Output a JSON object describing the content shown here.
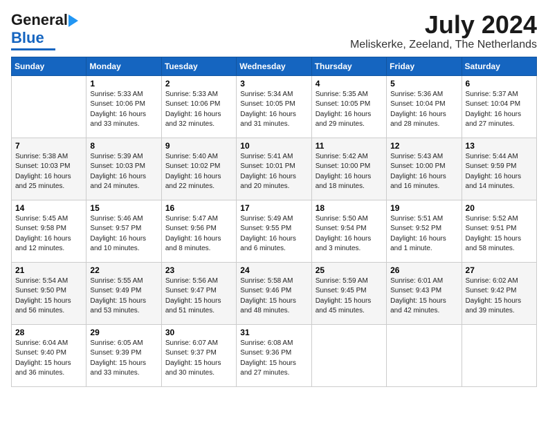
{
  "header": {
    "logo_general": "General",
    "logo_blue": "Blue",
    "title": "July 2024",
    "subtitle": "Meliskerke, Zeeland, The Netherlands"
  },
  "days_of_week": [
    "Sunday",
    "Monday",
    "Tuesday",
    "Wednesday",
    "Thursday",
    "Friday",
    "Saturday"
  ],
  "weeks": [
    [
      {
        "day": "",
        "info": ""
      },
      {
        "day": "1",
        "info": "Sunrise: 5:33 AM\nSunset: 10:06 PM\nDaylight: 16 hours\nand 33 minutes."
      },
      {
        "day": "2",
        "info": "Sunrise: 5:33 AM\nSunset: 10:06 PM\nDaylight: 16 hours\nand 32 minutes."
      },
      {
        "day": "3",
        "info": "Sunrise: 5:34 AM\nSunset: 10:05 PM\nDaylight: 16 hours\nand 31 minutes."
      },
      {
        "day": "4",
        "info": "Sunrise: 5:35 AM\nSunset: 10:05 PM\nDaylight: 16 hours\nand 29 minutes."
      },
      {
        "day": "5",
        "info": "Sunrise: 5:36 AM\nSunset: 10:04 PM\nDaylight: 16 hours\nand 28 minutes."
      },
      {
        "day": "6",
        "info": "Sunrise: 5:37 AM\nSunset: 10:04 PM\nDaylight: 16 hours\nand 27 minutes."
      }
    ],
    [
      {
        "day": "7",
        "info": "Sunrise: 5:38 AM\nSunset: 10:03 PM\nDaylight: 16 hours\nand 25 minutes."
      },
      {
        "day": "8",
        "info": "Sunrise: 5:39 AM\nSunset: 10:03 PM\nDaylight: 16 hours\nand 24 minutes."
      },
      {
        "day": "9",
        "info": "Sunrise: 5:40 AM\nSunset: 10:02 PM\nDaylight: 16 hours\nand 22 minutes."
      },
      {
        "day": "10",
        "info": "Sunrise: 5:41 AM\nSunset: 10:01 PM\nDaylight: 16 hours\nand 20 minutes."
      },
      {
        "day": "11",
        "info": "Sunrise: 5:42 AM\nSunset: 10:00 PM\nDaylight: 16 hours\nand 18 minutes."
      },
      {
        "day": "12",
        "info": "Sunrise: 5:43 AM\nSunset: 10:00 PM\nDaylight: 16 hours\nand 16 minutes."
      },
      {
        "day": "13",
        "info": "Sunrise: 5:44 AM\nSunset: 9:59 PM\nDaylight: 16 hours\nand 14 minutes."
      }
    ],
    [
      {
        "day": "14",
        "info": "Sunrise: 5:45 AM\nSunset: 9:58 PM\nDaylight: 16 hours\nand 12 minutes."
      },
      {
        "day": "15",
        "info": "Sunrise: 5:46 AM\nSunset: 9:57 PM\nDaylight: 16 hours\nand 10 minutes."
      },
      {
        "day": "16",
        "info": "Sunrise: 5:47 AM\nSunset: 9:56 PM\nDaylight: 16 hours\nand 8 minutes."
      },
      {
        "day": "17",
        "info": "Sunrise: 5:49 AM\nSunset: 9:55 PM\nDaylight: 16 hours\nand 6 minutes."
      },
      {
        "day": "18",
        "info": "Sunrise: 5:50 AM\nSunset: 9:54 PM\nDaylight: 16 hours\nand 3 minutes."
      },
      {
        "day": "19",
        "info": "Sunrise: 5:51 AM\nSunset: 9:52 PM\nDaylight: 16 hours\nand 1 minute."
      },
      {
        "day": "20",
        "info": "Sunrise: 5:52 AM\nSunset: 9:51 PM\nDaylight: 15 hours\nand 58 minutes."
      }
    ],
    [
      {
        "day": "21",
        "info": "Sunrise: 5:54 AM\nSunset: 9:50 PM\nDaylight: 15 hours\nand 56 minutes."
      },
      {
        "day": "22",
        "info": "Sunrise: 5:55 AM\nSunset: 9:49 PM\nDaylight: 15 hours\nand 53 minutes."
      },
      {
        "day": "23",
        "info": "Sunrise: 5:56 AM\nSunset: 9:47 PM\nDaylight: 15 hours\nand 51 minutes."
      },
      {
        "day": "24",
        "info": "Sunrise: 5:58 AM\nSunset: 9:46 PM\nDaylight: 15 hours\nand 48 minutes."
      },
      {
        "day": "25",
        "info": "Sunrise: 5:59 AM\nSunset: 9:45 PM\nDaylight: 15 hours\nand 45 minutes."
      },
      {
        "day": "26",
        "info": "Sunrise: 6:01 AM\nSunset: 9:43 PM\nDaylight: 15 hours\nand 42 minutes."
      },
      {
        "day": "27",
        "info": "Sunrise: 6:02 AM\nSunset: 9:42 PM\nDaylight: 15 hours\nand 39 minutes."
      }
    ],
    [
      {
        "day": "28",
        "info": "Sunrise: 6:04 AM\nSunset: 9:40 PM\nDaylight: 15 hours\nand 36 minutes."
      },
      {
        "day": "29",
        "info": "Sunrise: 6:05 AM\nSunset: 9:39 PM\nDaylight: 15 hours\nand 33 minutes."
      },
      {
        "day": "30",
        "info": "Sunrise: 6:07 AM\nSunset: 9:37 PM\nDaylight: 15 hours\nand 30 minutes."
      },
      {
        "day": "31",
        "info": "Sunrise: 6:08 AM\nSunset: 9:36 PM\nDaylight: 15 hours\nand 27 minutes."
      },
      {
        "day": "",
        "info": ""
      },
      {
        "day": "",
        "info": ""
      },
      {
        "day": "",
        "info": ""
      }
    ]
  ]
}
